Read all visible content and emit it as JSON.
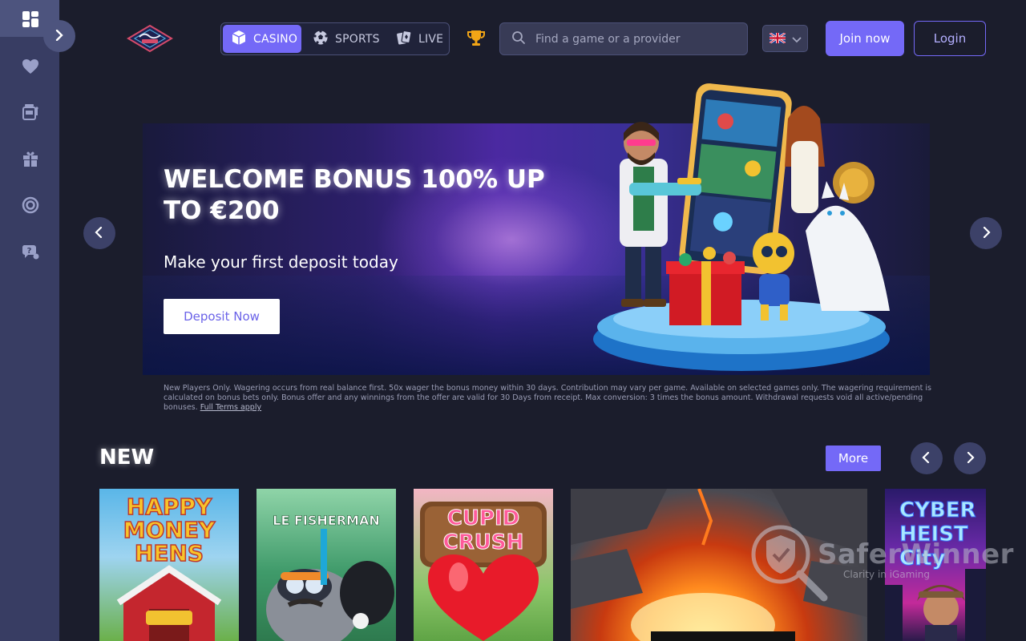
{
  "sidebar": {
    "items": [
      {
        "icon": "dashboard-icon"
      },
      {
        "icon": "heart-icon"
      },
      {
        "icon": "slot-machine-icon"
      },
      {
        "icon": "gift-icon"
      },
      {
        "icon": "target-icon"
      },
      {
        "icon": "support-icon"
      }
    ],
    "expand_icon": "chevron-right-icon"
  },
  "header": {
    "tabs": [
      {
        "label": "CASINO",
        "icon": "cube-icon",
        "active": true
      },
      {
        "label": "SPORTS",
        "icon": "soccer-ball-icon",
        "active": false
      },
      {
        "label": "LIVE",
        "icon": "cards-icon",
        "active": false
      }
    ],
    "search_placeholder": "Find a game or a provider",
    "language": "en-GB",
    "join_label": "Join now",
    "login_label": "Login"
  },
  "banner": {
    "title": "WELCOME BONUS 100% UP TO €200",
    "subtitle": "Make your first deposit today",
    "cta": "Deposit Now",
    "terms": "New Players Only. Wagering occurs from real balance first. 50x wager the bonus money within 30 days. Contribution may vary per game. Available on selected games only. The wagering requirement is calculated on bonus bets only. Bonus offer and any winnings from the offer are valid for 30 Days from receipt. Max conversion: 3 times the bonus amount. Withdrawal requests void all active/pending bonuses.",
    "terms_link": "Full Terms apply"
  },
  "new_section": {
    "title": "NEW",
    "more_label": "More",
    "games": [
      {
        "name": "HAPPY MONEY HENS"
      },
      {
        "name": "LE FISHERMAN"
      },
      {
        "name": "CUPID CRUSH"
      },
      {
        "name": ""
      },
      {
        "name": "CYBER HEIST City"
      }
    ]
  },
  "watermark": {
    "title": "SaferWinner",
    "tagline": "Clarity in iGaming"
  },
  "colors": {
    "accent": "#7469f7",
    "sidebar": "#383d63",
    "background": "#1b1d2c"
  }
}
